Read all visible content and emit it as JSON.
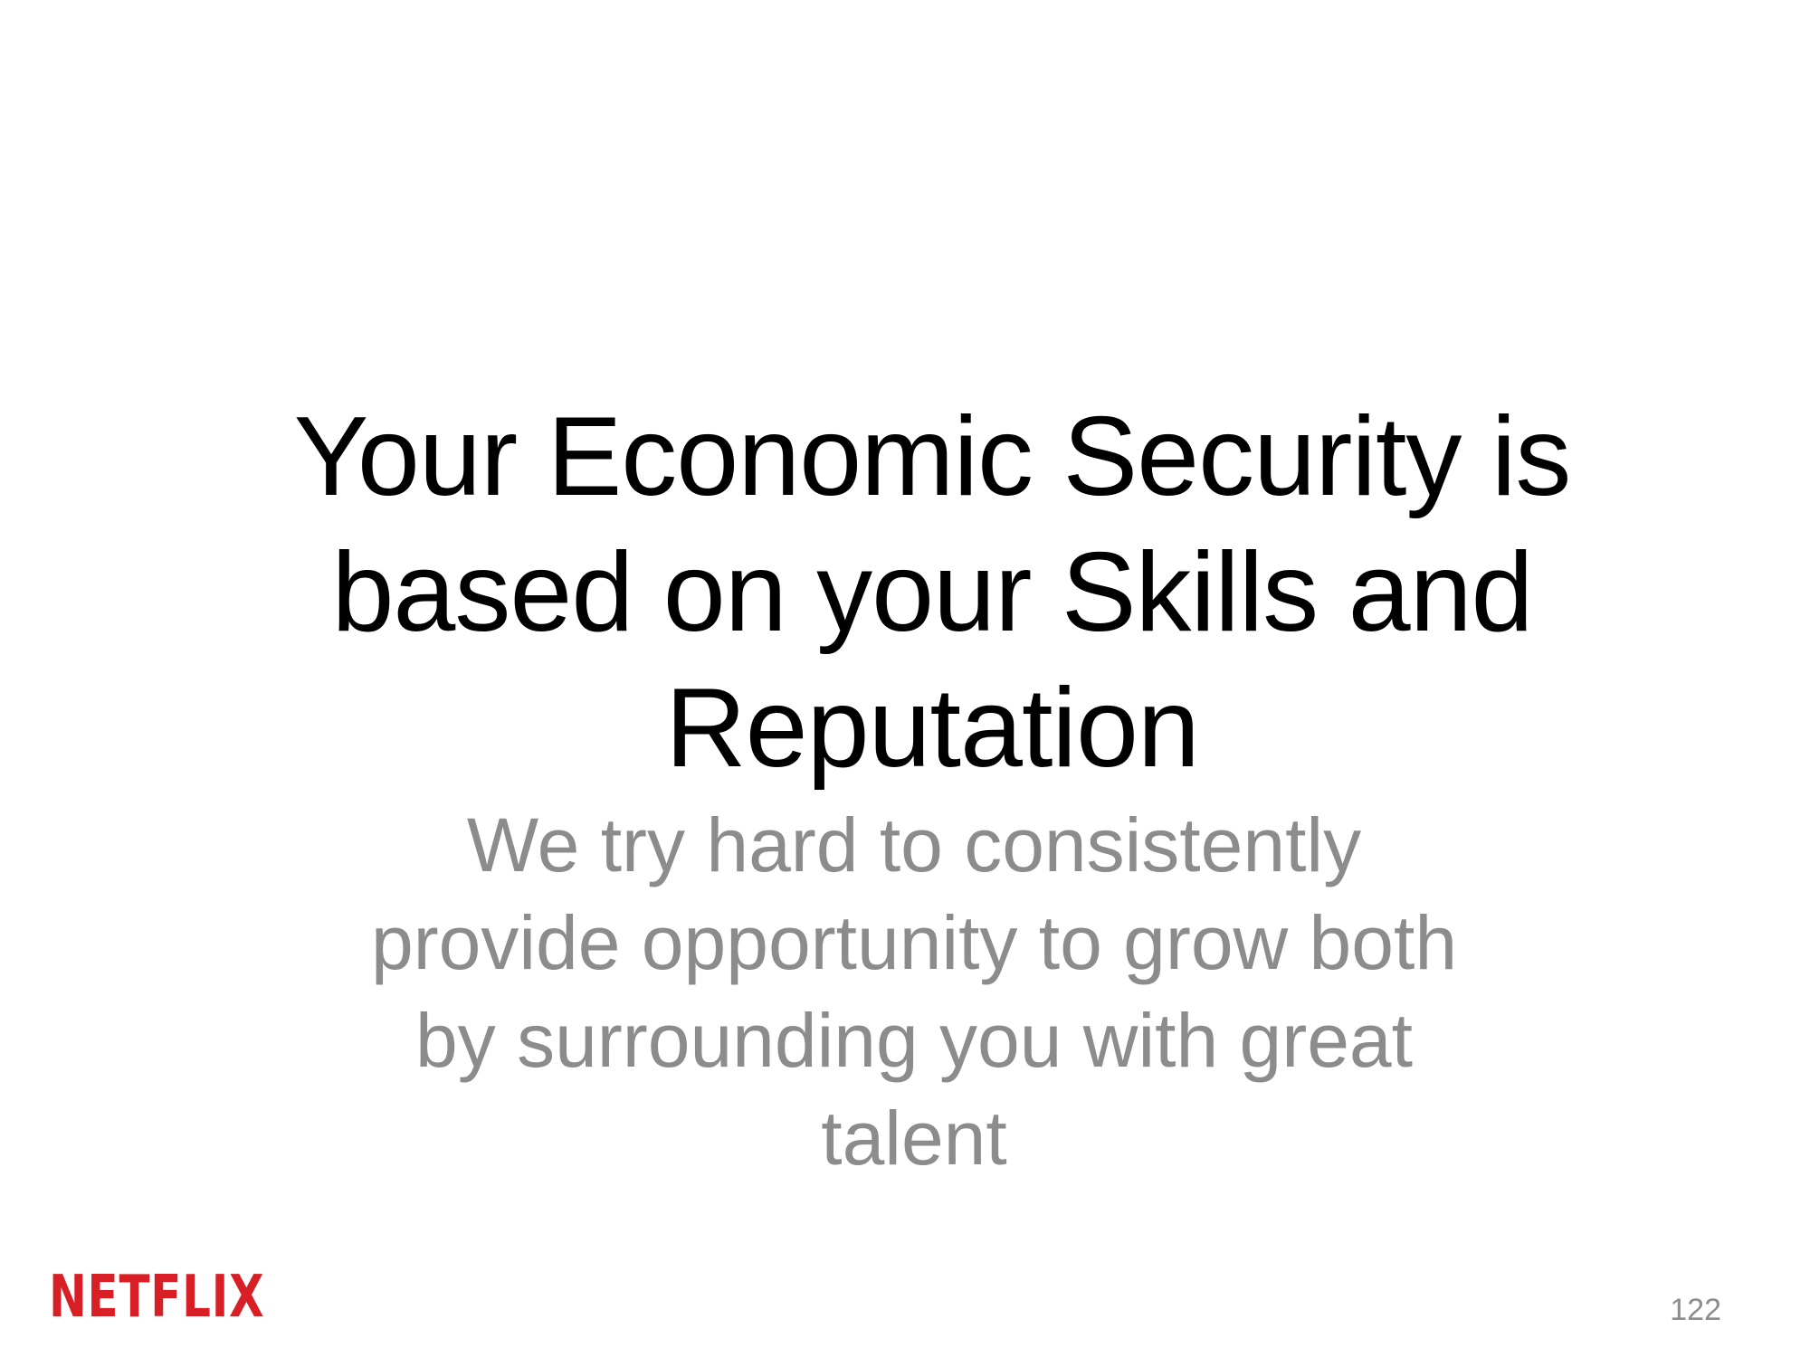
{
  "slide": {
    "title_lines": [
      "Your Economic Security is",
      "based on your Skills and",
      "Reputation"
    ],
    "subtitle_lines": [
      "We try hard to consistently",
      "provide opportunity to grow both",
      "by surrounding you with great",
      "talent"
    ],
    "logo_text": "NETFLIX",
    "page_number": "122"
  },
  "colors": {
    "title": "#000000",
    "subtitle": "#8c8c8c",
    "logo": "#d81f26",
    "background": "#ffffff"
  }
}
